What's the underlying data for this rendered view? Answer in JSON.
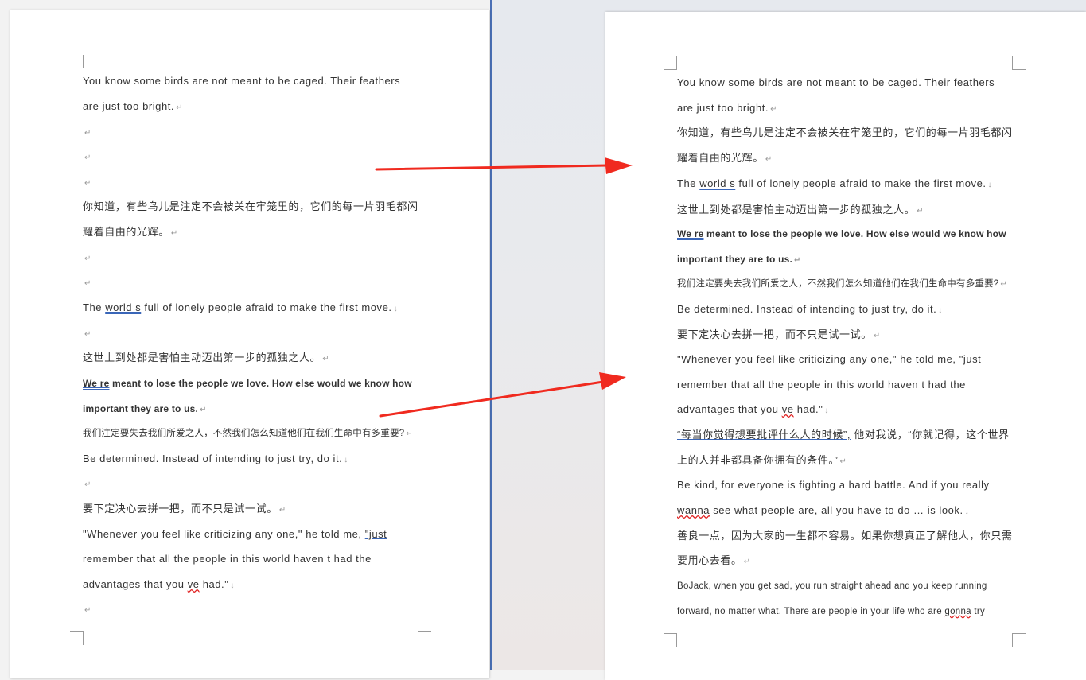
{
  "colors": {
    "arrow": "#f02a1f",
    "divider": "#4a6fb5",
    "text": "#333333",
    "mark": "#9a9a9a"
  },
  "paragraph_mark": "↵",
  "line_break_mark": "↓",
  "left_page": {
    "lines": {
      "l1": "You know some birds are not meant to be caged. Their feathers",
      "l2": "are just too bright.",
      "l3": "你知道，有些鸟儿是注定不会被关在牢笼里的，它们的每一片羽毛都闪",
      "l4": "耀着自由的光辉。",
      "l5a": "The ",
      "l5b": "world s",
      "l5c": " full of lonely people afraid to make the first move.",
      "l6": "这世上到处都是害怕主动迈出第一步的孤独之人。",
      "l7a": "We re",
      "l7b": " meant to lose the people we love. How else would we know how",
      "l8": "important they are to us.",
      "l9": "我们注定要失去我们所爱之人，不然我们怎么知道他们在我们生命中有多重要?",
      "l10": "Be determined. Instead of intending to just try, do it.",
      "l11": "要下定决心去拼一把，而不只是试一试。",
      "l12a": "\"Whenever you feel like criticizing any one,\" he told me, ",
      "l12b": "\"just",
      "l13": "remember that all the people in this world haven t had the",
      "l14a": "advantages that you ",
      "l14b": "ve",
      "l14c": " had.\""
    }
  },
  "right_page": {
    "lines": {
      "r1": "You know some birds are not meant to be caged. Their feathers",
      "r2": "are just too bright.",
      "r3": "你知道，有些鸟儿是注定不会被关在牢笼里的，它们的每一片羽毛都闪",
      "r4": "耀着自由的光辉。",
      "r5a": "The ",
      "r5b": "world s",
      "r5c": " full of lonely people afraid to make the first move.",
      "r6": "这世上到处都是害怕主动迈出第一步的孤独之人。",
      "r7a": "We re",
      "r7b": " meant to lose the people we love. How else would we know how",
      "r8": "important they are to us.",
      "r9": "我们注定要失去我们所爱之人，不然我们怎么知道他们在我们生命中有多重要?",
      "r10": "Be determined. Instead of intending to just try, do it.",
      "r11": "要下定决心去拼一把，而不只是试一试。",
      "r12": "\"Whenever you feel like criticizing any one,\" he told me, \"just",
      "r13": "remember that all the people in this world haven t had the",
      "r14a": "advantages that you ",
      "r14b": "ve",
      "r14c": " had.\"",
      "r15a": "“每当你觉得想要批评什么人的时候”,",
      "r15b": " 他对我说，“你就记得，这个世界",
      "r16": "上的人并非都具备你拥有的条件。”",
      "r17": "Be kind, for everyone is fighting a hard battle. And if you really",
      "r18a": "wanna",
      "r18b": " see what people are, all you have to do … is look.",
      "r19": "善良一点，因为大家的一生都不容易。如果你想真正了解他人，你只需",
      "r20": "要用心去看。",
      "r21": "BoJack, when you get sad, you run straight ahead and you keep running",
      "r22a": "forward, no matter what. There are people in your life who are ",
      "r22b": "gonna",
      "r22c": " try"
    }
  }
}
